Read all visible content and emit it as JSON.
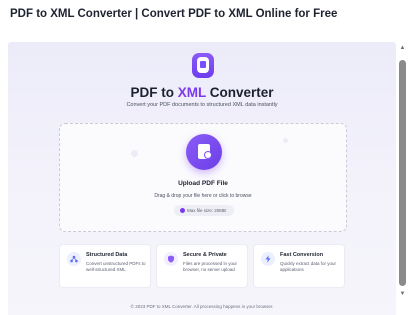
{
  "window": {
    "title": "PDF to XML Converter | Convert PDF to XML Online for Free"
  },
  "header": {
    "title_prefix": "PDF to ",
    "title_accent": "XML",
    "title_suffix": " Converter",
    "subtitle": "Convert your PDF documents to structured XML data instantly",
    "logo_icon": "file-upload-icon"
  },
  "upload": {
    "title": "Upload PDF File",
    "hint": "Drag & drop your file here or click to browse",
    "size_badge": "Max file size: 20MB",
    "icon": "file-upload-icon"
  },
  "features": [
    {
      "title": "Structured Data",
      "desc": "Convert unstructured PDFs to well-structured XML",
      "icon": "structure-icon",
      "color": "#5b6cf0"
    },
    {
      "title": "Secure & Private",
      "desc": "Files are processed in your browser, no server upload",
      "icon": "shield-icon",
      "color": "#8b5cf6"
    },
    {
      "title": "Fast Conversion",
      "desc": "Quickly extract data for your applications",
      "icon": "bolt-icon",
      "color": "#4f6ef7"
    }
  ],
  "footer": {
    "text": "© 2023 PDF to XML Converter. All processing happens in your browser."
  },
  "colors": {
    "accent": "#7c3aed",
    "background": "#efeefa"
  }
}
